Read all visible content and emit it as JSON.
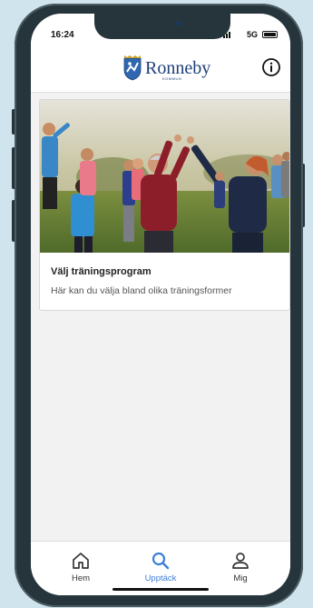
{
  "status_bar": {
    "time": "16:24",
    "network": "5G"
  },
  "header": {
    "logo_text": "Ronneby",
    "logo_subtext": "KOMMUN"
  },
  "card": {
    "title": "Välj träningsprogram",
    "description": "Här kan du välja bland olika träningsformer"
  },
  "bottom_nav": {
    "items": [
      {
        "label": "Hem",
        "icon": "home-icon",
        "active": false
      },
      {
        "label": "Upptäck",
        "icon": "search-icon",
        "active": true
      },
      {
        "label": "Mig",
        "icon": "person-icon",
        "active": false
      }
    ]
  },
  "colors": {
    "accent": "#3b7fd6",
    "brand": "#1e3f7a",
    "inactive": "#333333",
    "background": "#f2f2f2"
  }
}
